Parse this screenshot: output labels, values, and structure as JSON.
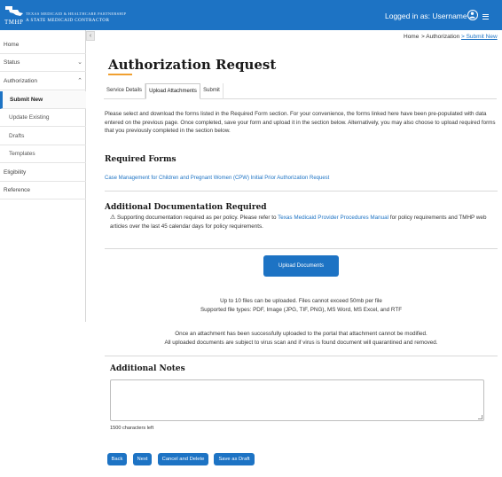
{
  "header": {
    "logo_text": "TMHP",
    "brand_top": "TEXAS MEDICAID & HEALTHCARE PARTNERSHIP",
    "brand_bottom": "A STATE MEDICAID CONTRACTOR",
    "user_label": "Logged in as: Username",
    "bg_color": "#1d73c4"
  },
  "sidebar": {
    "collapse_glyph": "‹",
    "items": [
      {
        "label": "Home",
        "chevron": ""
      },
      {
        "label": "Status",
        "chevron": "⌄"
      },
      {
        "label": "Authorization",
        "chevron": "⌃"
      },
      {
        "label": "Submit New",
        "chevron": ""
      },
      {
        "label": "Update Existing",
        "chevron": ""
      },
      {
        "label": "Drafts",
        "chevron": ""
      },
      {
        "label": "Templates",
        "chevron": ""
      },
      {
        "label": "Eligibility",
        "chevron": ""
      },
      {
        "label": "Reference",
        "chevron": ""
      }
    ],
    "active_item": "Submit New"
  },
  "breadcrumb": {
    "home": "Home",
    "authorization": "> Authorization",
    "submit_new": "> Submit New"
  },
  "page_title": "Authorization Request",
  "tabs": [
    {
      "label": "Service Details"
    },
    {
      "label": "Upload Attachments"
    },
    {
      "label": "Submit"
    }
  ],
  "active_tab": "Upload Attachments",
  "intro": "Please select and download the forms listed in the Required Form section. For your convenience, the forms linked here have been pre-populated with data entered on the previous page. Once completed, save your form and upload it in the section below. Alternatively, you may also choose to upload required forms that you previously completed in the section below.",
  "required_forms": {
    "heading": "Required Forms",
    "link": "Case Management for Children and Pregnant Women (CPW) Initial Prior Authorization Request"
  },
  "additional_docs": {
    "heading": "Additional Documentation Required",
    "warning_icon": "⚠",
    "text_before": "Supporting documentation required as per policy. Please refer to ",
    "manual_link": "Texas Medicaid Provider Procedures Manual",
    "text_after": " for policy requirements and TMHP web articles over the last 45 calendar days for policy requirements."
  },
  "upload": {
    "button_label": "Upload Documents",
    "limit_line": "Up to 10 files can be uploaded. Files cannot exceed 50mb per file",
    "types_line": "Supported file types: PDF, Image (JPG, TIF, PNG), MS Word, MS Excel, and RTF",
    "note_line1": "Once an attachment has been successfully uploaded to the portal that attachment cannot be modified.",
    "note_line2": "All uploaded documents are subject to virus scan and if virus is found document will quarantined and removed."
  },
  "notes": {
    "heading": "Additional Notes",
    "value": "",
    "chars_left": "1500 characters left"
  },
  "actions": {
    "back": "Back",
    "next": "Next",
    "cancel": "Cancel and Delete",
    "save": "Save as Draft"
  }
}
